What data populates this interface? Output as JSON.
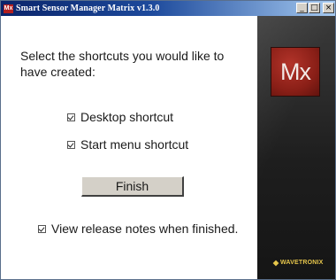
{
  "window": {
    "title": "Smart Sensor Manager Matrix v1.3.0",
    "app_icon_text": "Mx",
    "controls": {
      "minimize": "_",
      "maximize": "□",
      "close": "×"
    }
  },
  "installer": {
    "prompt": "Select the shortcuts you would like to have created:",
    "options": [
      {
        "label": "Desktop shortcut",
        "checked": true
      },
      {
        "label": "Start menu shortcut",
        "checked": true
      }
    ],
    "finish_label": "Finish",
    "release_notes": {
      "label": "View release notes when finished.",
      "checked": true
    }
  },
  "branding": {
    "logo_text": "Mx",
    "company": "WAVETRONIX",
    "colors": {
      "logo_red": "#8a1f17",
      "brand_yellow": "#e6c64b",
      "panel_dark": "#1e1e1e",
      "titlebar_blue": "#0a246a"
    }
  }
}
